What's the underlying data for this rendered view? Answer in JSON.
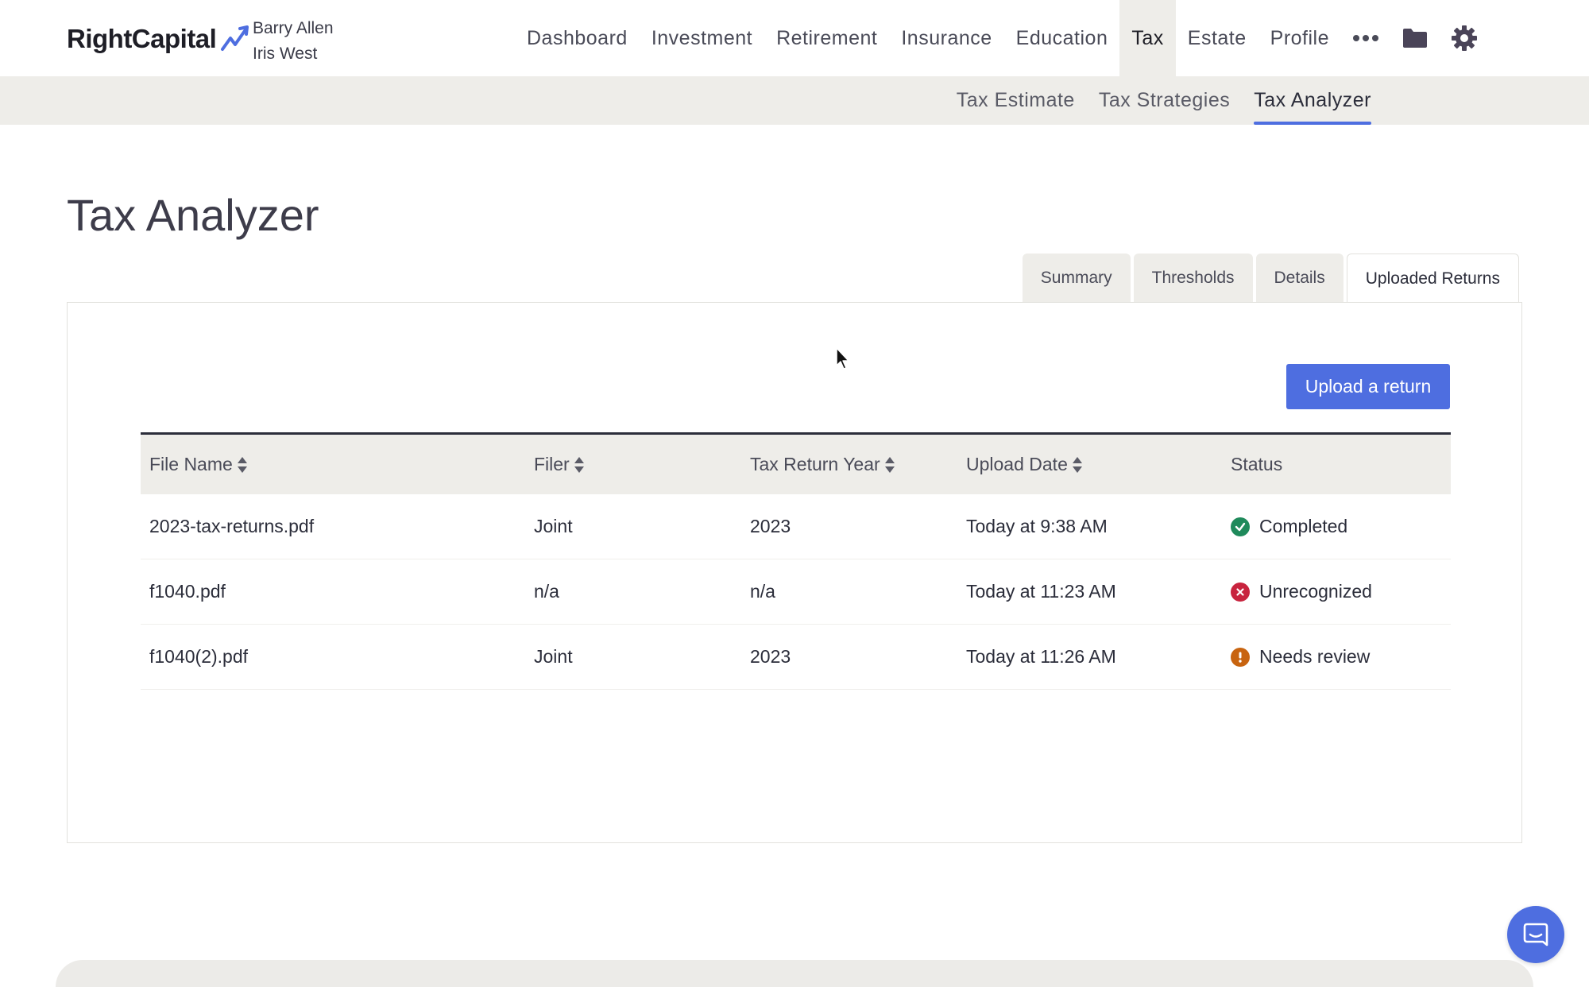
{
  "app": {
    "brand": "RightCapital",
    "clients": [
      "Barry Allen",
      "Iris West"
    ]
  },
  "nav": {
    "items": [
      "Dashboard",
      "Investment",
      "Retirement",
      "Insurance",
      "Education",
      "Tax",
      "Estate",
      "Profile"
    ],
    "active": "Tax",
    "more_icon": "more-dots-icon",
    "folder_icon": "folder-icon",
    "settings_icon": "gear-icon"
  },
  "subnav": {
    "items": [
      "Tax Estimate",
      "Tax Strategies",
      "Tax Analyzer"
    ],
    "active": "Tax Analyzer"
  },
  "page": {
    "title": "Tax Analyzer",
    "tabs": [
      "Summary",
      "Thresholds",
      "Details",
      "Uploaded Returns"
    ],
    "active_tab": "Uploaded Returns",
    "upload_label": "Upload a return"
  },
  "table": {
    "headers": [
      "File Name",
      "Filer",
      "Tax Return Year",
      "Upload Date",
      "Status"
    ],
    "rows": [
      {
        "file": "2023-tax-returns.pdf",
        "filer": "Joint",
        "year": "2023",
        "date": "Today at 9:38 AM",
        "status": "Completed",
        "status_type": "success"
      },
      {
        "file": "f1040.pdf",
        "filer": "n/a",
        "year": "n/a",
        "date": "Today at 11:23 AM",
        "status": "Unrecognized",
        "status_type": "error"
      },
      {
        "file": "f1040(2).pdf",
        "filer": "Joint",
        "year": "2023",
        "date": "Today at 11:26 AM",
        "status": "Needs review",
        "status_type": "warning"
      }
    ]
  },
  "colors": {
    "accent": "#4e6ee0",
    "success": "#1f8a5b",
    "error": "#c8233e",
    "warning": "#c86410",
    "nav_bg": "#eeede9"
  }
}
